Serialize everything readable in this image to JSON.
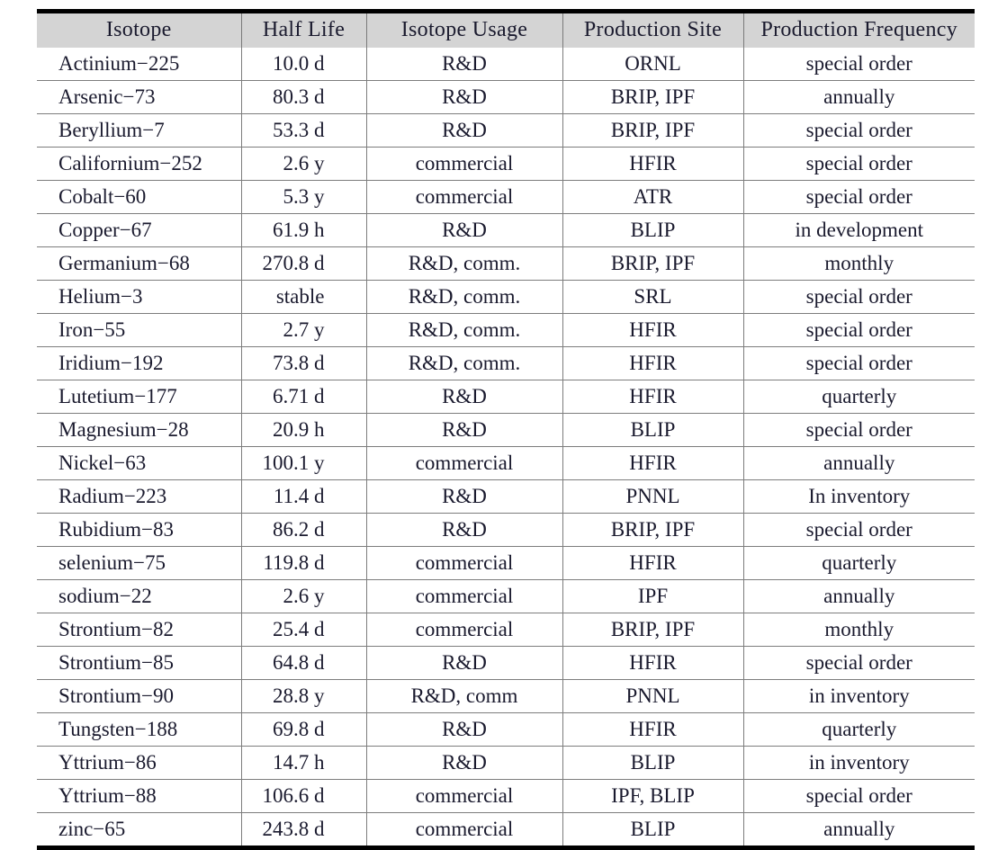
{
  "table": {
    "columns": [
      {
        "key": "isotope",
        "label": "Isotope"
      },
      {
        "key": "half_life",
        "label": "Half Life"
      },
      {
        "key": "usage",
        "label": "Isotope Usage"
      },
      {
        "key": "site",
        "label": "Production Site"
      },
      {
        "key": "frequency",
        "label": "Production Frequency"
      }
    ],
    "header_background": "#d4d4d4",
    "rule_color": "#000000",
    "grid_color": "#7d7d7d",
    "rows": [
      {
        "isotope": "Actinium−225",
        "half_life": "10.0 d",
        "usage": "R&D",
        "site": "ORNL",
        "frequency": "special order"
      },
      {
        "isotope": "Arsenic−73",
        "half_life": "80.3 d",
        "usage": "R&D",
        "site": "BRIP, IPF",
        "frequency": "annually"
      },
      {
        "isotope": "Beryllium−7",
        "half_life": "53.3 d",
        "usage": "R&D",
        "site": "BRIP, IPF",
        "frequency": "special order"
      },
      {
        "isotope": "Californium−252",
        "half_life": "2.6 y",
        "usage": "commercial",
        "site": "HFIR",
        "frequency": "special order"
      },
      {
        "isotope": "Cobalt−60",
        "half_life": "5.3 y",
        "usage": "commercial",
        "site": "ATR",
        "frequency": "special order"
      },
      {
        "isotope": "Copper−67",
        "half_life": "61.9 h",
        "usage": "R&D",
        "site": "BLIP",
        "frequency": "in development"
      },
      {
        "isotope": "Germanium−68",
        "half_life": "270.8 d",
        "usage": "R&D, comm.",
        "site": "BRIP, IPF",
        "frequency": "monthly"
      },
      {
        "isotope": "Helium−3",
        "half_life": "stable",
        "usage": "R&D, comm.",
        "site": "SRL",
        "frequency": "special order"
      },
      {
        "isotope": "Iron−55",
        "half_life": "2.7 y",
        "usage": "R&D, comm.",
        "site": "HFIR",
        "frequency": "special order"
      },
      {
        "isotope": "Iridium−192",
        "half_life": "73.8 d",
        "usage": "R&D, comm.",
        "site": "HFIR",
        "frequency": "special order"
      },
      {
        "isotope": "Lutetium−177",
        "half_life": "6.71 d",
        "usage": "R&D",
        "site": "HFIR",
        "frequency": "quarterly"
      },
      {
        "isotope": "Magnesium−28",
        "half_life": "20.9 h",
        "usage": "R&D",
        "site": "BLIP",
        "frequency": "special order"
      },
      {
        "isotope": "Nickel−63",
        "half_life": "100.1 y",
        "usage": "commercial",
        "site": "HFIR",
        "frequency": "annually"
      },
      {
        "isotope": "Radium−223",
        "half_life": "11.4 d",
        "usage": "R&D",
        "site": "PNNL",
        "frequency": "In inventory"
      },
      {
        "isotope": "Rubidium−83",
        "half_life": "86.2 d",
        "usage": "R&D",
        "site": "BRIP, IPF",
        "frequency": "special order"
      },
      {
        "isotope": "selenium−75",
        "half_life": "119.8 d",
        "usage": "commercial",
        "site": "HFIR",
        "frequency": "quarterly"
      },
      {
        "isotope": "sodium−22",
        "half_life": "2.6 y",
        "usage": "commercial",
        "site": "IPF",
        "frequency": "annually"
      },
      {
        "isotope": "Strontium−82",
        "half_life": "25.4 d",
        "usage": "commercial",
        "site": "BRIP, IPF",
        "frequency": "monthly"
      },
      {
        "isotope": "Strontium−85",
        "half_life": "64.8 d",
        "usage": "R&D",
        "site": "HFIR",
        "frequency": "special order"
      },
      {
        "isotope": "Strontium−90",
        "half_life": "28.8 y",
        "usage": "R&D, comm",
        "site": "PNNL",
        "frequency": "in inventory"
      },
      {
        "isotope": "Tungsten−188",
        "half_life": "69.8 d",
        "usage": "R&D",
        "site": "HFIR",
        "frequency": "quarterly"
      },
      {
        "isotope": "Yttrium−86",
        "half_life": "14.7 h",
        "usage": "R&D",
        "site": "BLIP",
        "frequency": "in inventory"
      },
      {
        "isotope": "Yttrium−88",
        "half_life": "106.6 d",
        "usage": "commercial",
        "site": "IPF, BLIP",
        "frequency": "special order"
      },
      {
        "isotope": "zinc−65",
        "half_life": "243.8 d",
        "usage": "commercial",
        "site": "BLIP",
        "frequency": "annually"
      }
    ]
  }
}
